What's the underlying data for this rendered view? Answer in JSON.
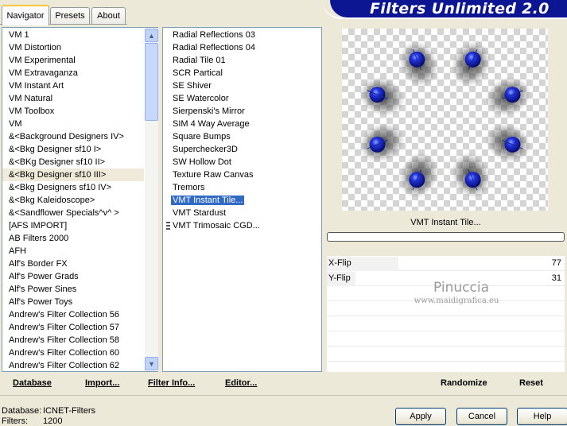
{
  "tabs": [
    {
      "label": "Navigator",
      "active": true
    },
    {
      "label": "Presets",
      "active": false
    },
    {
      "label": "About",
      "active": false
    }
  ],
  "banner": {
    "title": "Filters Unlimited 2.0",
    "color": "#0c1592"
  },
  "categories": {
    "items": [
      "VM 1",
      "VM Distortion",
      "VM Experimental",
      "VM Extravaganza",
      "VM Instant Art",
      "VM Natural",
      "VM Toolbox",
      "VM",
      "&<Background Designers IV>",
      "&<Bkg Designer sf10 I>",
      "&<BKg Designer sf10 II>",
      "&<Bkg Designer sf10 III>",
      "&<Bkg Designers sf10 IV>",
      "&<Bkg Kaleidoscope>",
      "&<Sandflower Specials^v^ >",
      "[AFS IMPORT]",
      "AB Filters 2000",
      "AFH",
      "Alf's Border FX",
      "Alf's Power Grads",
      "Alf's Power Sines",
      "Alf's Power Toys",
      "Andrew's Filter Collection 56",
      "Andrew's Filter Collection 57",
      "Andrew's Filter Collection 58",
      "Andrew's Filter Collection 60",
      "Andrew's Filter Collection 62"
    ],
    "selected_index": 11
  },
  "filters": {
    "items": [
      "Radial Reflections 03",
      "Radial Reflections 04",
      "Radial Tile 01",
      "SCR  Partical",
      "SE Shiver",
      "SE Watercolor",
      "Sierpenski's Mirror",
      "SIM 4 Way Average",
      "Square Bumps",
      "Superchecker3D",
      "SW Hollow Dot",
      "Texture Raw Canvas",
      "Tremors",
      "VMT Instant Tile...",
      "VMT Stardust",
      "VMT Trimosaic CGD..."
    ],
    "selected_index": 13
  },
  "preview": {
    "filter_name": "VMT Instant Tile..."
  },
  "params": [
    {
      "label": "X-Flip",
      "value": "77",
      "level": 77
    },
    {
      "label": "Y-Flip",
      "value": "31",
      "level": 31
    }
  ],
  "watermark": {
    "name": "Pinuccia",
    "url": "www.maidigrafica.eu"
  },
  "actions": {
    "database": "Database",
    "import": "Import...",
    "filter_info": "Filter Info...",
    "editor": "Editor...",
    "randomize": "Randomize",
    "reset": "Reset"
  },
  "status": {
    "database_label": "Database:",
    "database_value": "ICNET-Filters",
    "filters_label": "Filters:",
    "filters_value": "1200"
  },
  "buttons": {
    "apply": "Apply",
    "cancel": "Cancel",
    "help": "Help"
  }
}
